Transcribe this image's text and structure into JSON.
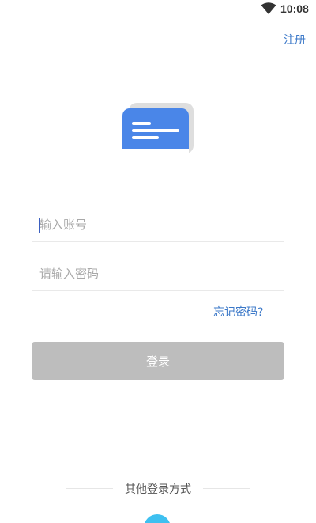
{
  "status_bar": {
    "time": "10:08",
    "wifi_icon": "wifi-icon"
  },
  "header": {
    "register_label": "注册"
  },
  "logo": {
    "icon": "message-card-logo",
    "colors": {
      "front": "#4a86e8",
      "back": "#dedede"
    }
  },
  "form": {
    "account": {
      "placeholder": "输入账号",
      "value": ""
    },
    "password": {
      "placeholder": "请输入密码",
      "value": ""
    },
    "forgot_label": "忘记密码?",
    "login_label": "登录",
    "login_button_color": "#bdbdbd"
  },
  "other_login": {
    "title": "其他登录方式",
    "icon": "social-login-icon",
    "icon_color": "#3ec0f0"
  },
  "colors": {
    "accent": "#3b78c8"
  }
}
